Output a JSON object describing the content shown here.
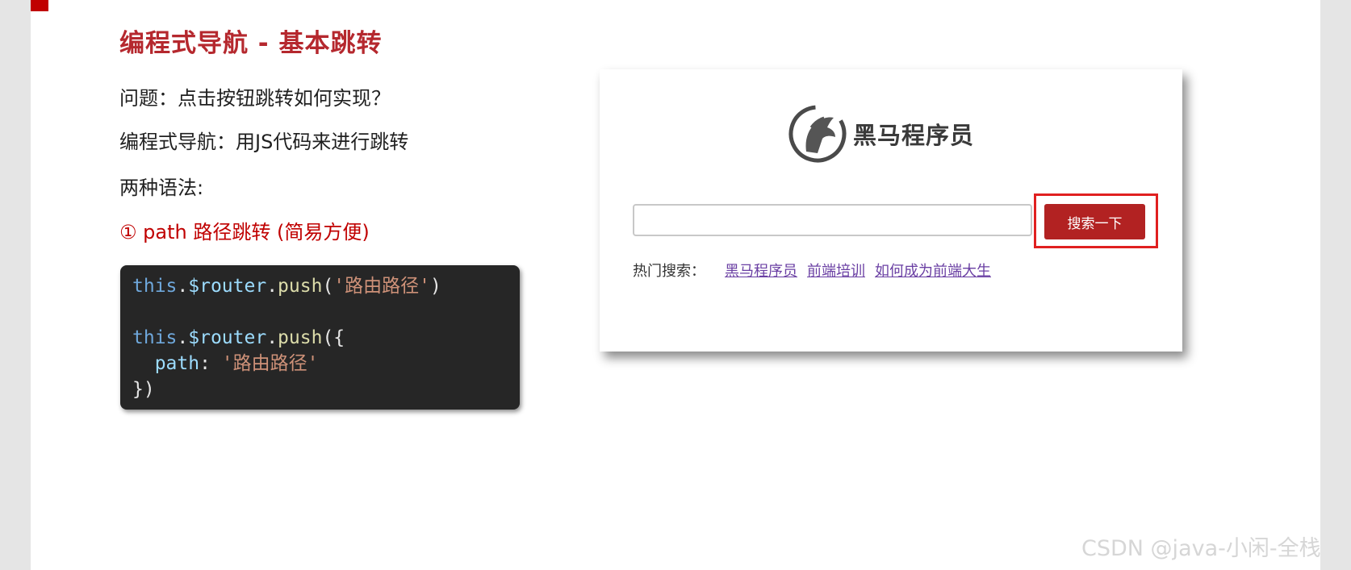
{
  "slide": {
    "title": "编程式导航 - 基本跳转",
    "question": "问题：点击按钮跳转如何实现？",
    "definition": "编程式导航：用JS代码来进行跳转",
    "syntax_heading": "两种语法:",
    "syntax_one": "① path 路径跳转 (简易方便)",
    "accent_color": "#b5282e"
  },
  "code": {
    "line1": {
      "kw": "this",
      "dot1": ".",
      "var": "$router",
      "dot2": ".",
      "fn": "push",
      "open": "(",
      "str": "'路由路径'",
      "close": ")"
    },
    "line3": {
      "kw": "this",
      "dot1": ".",
      "var": "$router",
      "dot2": ".",
      "fn": "push",
      "open": "({"
    },
    "line4": {
      "indent": "  ",
      "prop": "path",
      "colon": ": ",
      "str": "'路由路径'"
    },
    "line5": {
      "close": "})"
    }
  },
  "mock": {
    "brand_name": "黑马程序员",
    "logo_icon": "horse-logo-icon",
    "search_value": "",
    "search_button": "搜索一下",
    "hot_label": "热门搜索：",
    "hot_links": [
      "黑马程序员",
      "前端培训",
      "如何成为前端大生"
    ],
    "button_color": "#b22222",
    "highlight_color": "#e02020"
  },
  "watermark": "CSDN @java-小闲-全栈"
}
